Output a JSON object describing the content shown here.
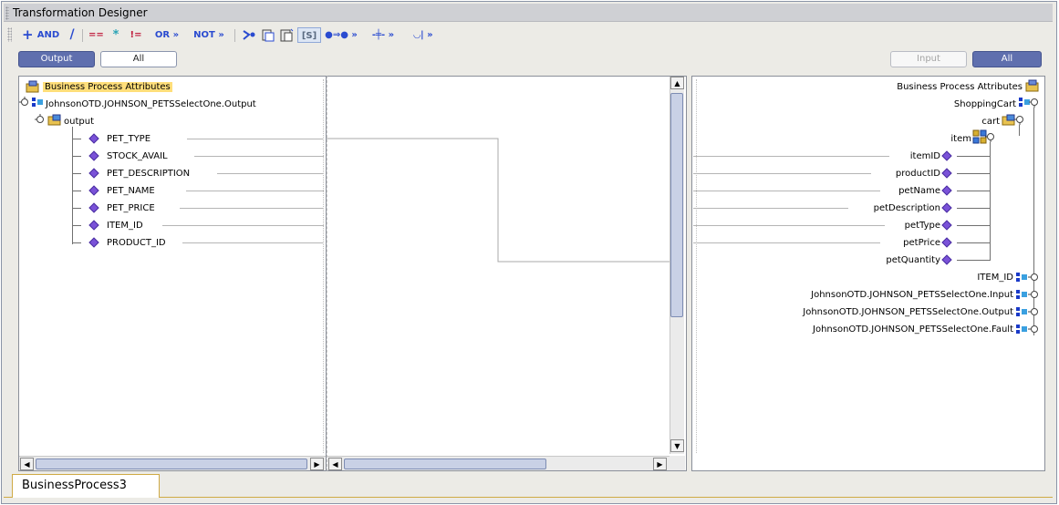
{
  "window": {
    "title": "Transformation Designer"
  },
  "toolbar": {
    "items": [
      {
        "name": "add",
        "label": "+",
        "icon": "plus-icon"
      },
      {
        "name": "and",
        "label": "AND"
      },
      {
        "name": "divide",
        "label": "/",
        "icon": "slash-icon"
      },
      {
        "name": "equals",
        "label": "=="
      },
      {
        "name": "asterisk",
        "label": "*",
        "icon": "asterisk-icon"
      },
      {
        "name": "not-equals",
        "label": "!="
      },
      {
        "name": "or",
        "label": "OR »"
      },
      {
        "name": "not",
        "label": "NOT »"
      },
      {
        "name": "mapper",
        "label": "",
        "icon": "mapper-icon"
      },
      {
        "name": "copy-object",
        "label": "",
        "icon": "copy-object-icon"
      },
      {
        "name": "paste-object",
        "label": "",
        "icon": "paste-object-icon"
      },
      {
        "name": "string-literal",
        "label": "[S]"
      },
      {
        "name": "link",
        "label": "»",
        "icon": "link-icon"
      },
      {
        "name": "transform",
        "label": "»",
        "icon": "transform-icon"
      },
      {
        "name": "merge",
        "label": "»",
        "icon": "merge-icon"
      }
    ]
  },
  "left_buttons": {
    "output": "Output",
    "all": "All"
  },
  "right_buttons": {
    "input": "Input",
    "all": "All"
  },
  "left_tree": {
    "root": "Business Process Attributes",
    "otd": "JohnsonOTD.JOHNSON_PETSSelectOne.Output",
    "output": "output",
    "fields": [
      "PET_TYPE",
      "STOCK_AVAIL",
      "PET_DESCRIPTION",
      "PET_NAME",
      "PET_PRICE",
      "ITEM_ID",
      "PRODUCT_ID"
    ]
  },
  "right_tree": {
    "root": "Business Process Attributes",
    "shopping_cart": "ShoppingCart",
    "cart": "cart",
    "item": "item",
    "fields": [
      "itemID",
      "productID",
      "petName",
      "petDescription",
      "petType",
      "petPrice",
      "petQuantity"
    ],
    "others": [
      "ITEM_ID",
      "JohnsonOTD.JOHNSON_PETSSelectOne.Input",
      "JohnsonOTD.JOHNSON_PETSSelectOne.Output",
      "JohnsonOTD.JOHNSON_PETSSelectOne.Fault"
    ]
  },
  "bottom_tab": {
    "label": "BusinessProcess3"
  }
}
